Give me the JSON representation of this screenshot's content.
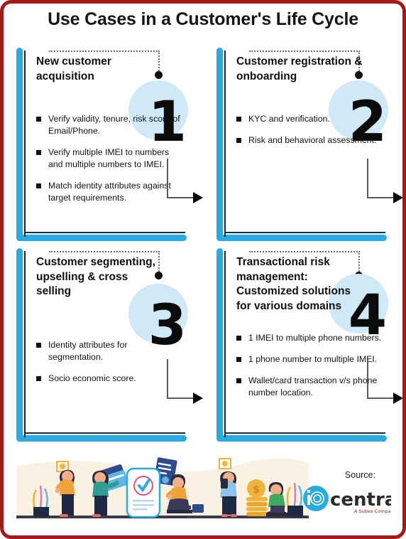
{
  "poster": {
    "title": "Use Cases in a Customer's Life Cycle",
    "frame_color": "#A81818",
    "accent_cyan": "#29ABE2",
    "accent_navy": "#132B45",
    "accent_pale_blue": "#CFE9F7"
  },
  "panels": [
    {
      "number": "1",
      "heading": "New customer acquisition",
      "bullets": [
        "Verify validity, tenure, risk score of Email/Phone.",
        "Verify multiple IMEI to numbers and multiple numbers to IMEI.",
        "Match identity attributes against target requirements."
      ]
    },
    {
      "number": "2",
      "heading": "Customer registration & onboarding",
      "bullets": [
        "KYC and verification.",
        "Risk and behavioral assessment."
      ]
    },
    {
      "number": "3",
      "heading": "Customer segmenting, upselling & cross selling",
      "bullets": [
        "Identity attributes for segmentation.",
        "Socio economic score."
      ]
    },
    {
      "number": "4",
      "heading": "Transactional risk management: Customized solutions for various domains",
      "bullets": [
        "1 IMEI to multiple phone numbers.",
        "1 phone number to multiple IMEI.",
        "Wallet/card transaction v/s phone number location."
      ]
    }
  ],
  "footer": {
    "source_label": "Source:",
    "logo_mark": "id-central-circle-icon",
    "logo_word": "central",
    "logo_tagline": "A Subex Company",
    "logo_color": "#29ABE2",
    "illustration": "people-fintech-identity-illustration"
  }
}
